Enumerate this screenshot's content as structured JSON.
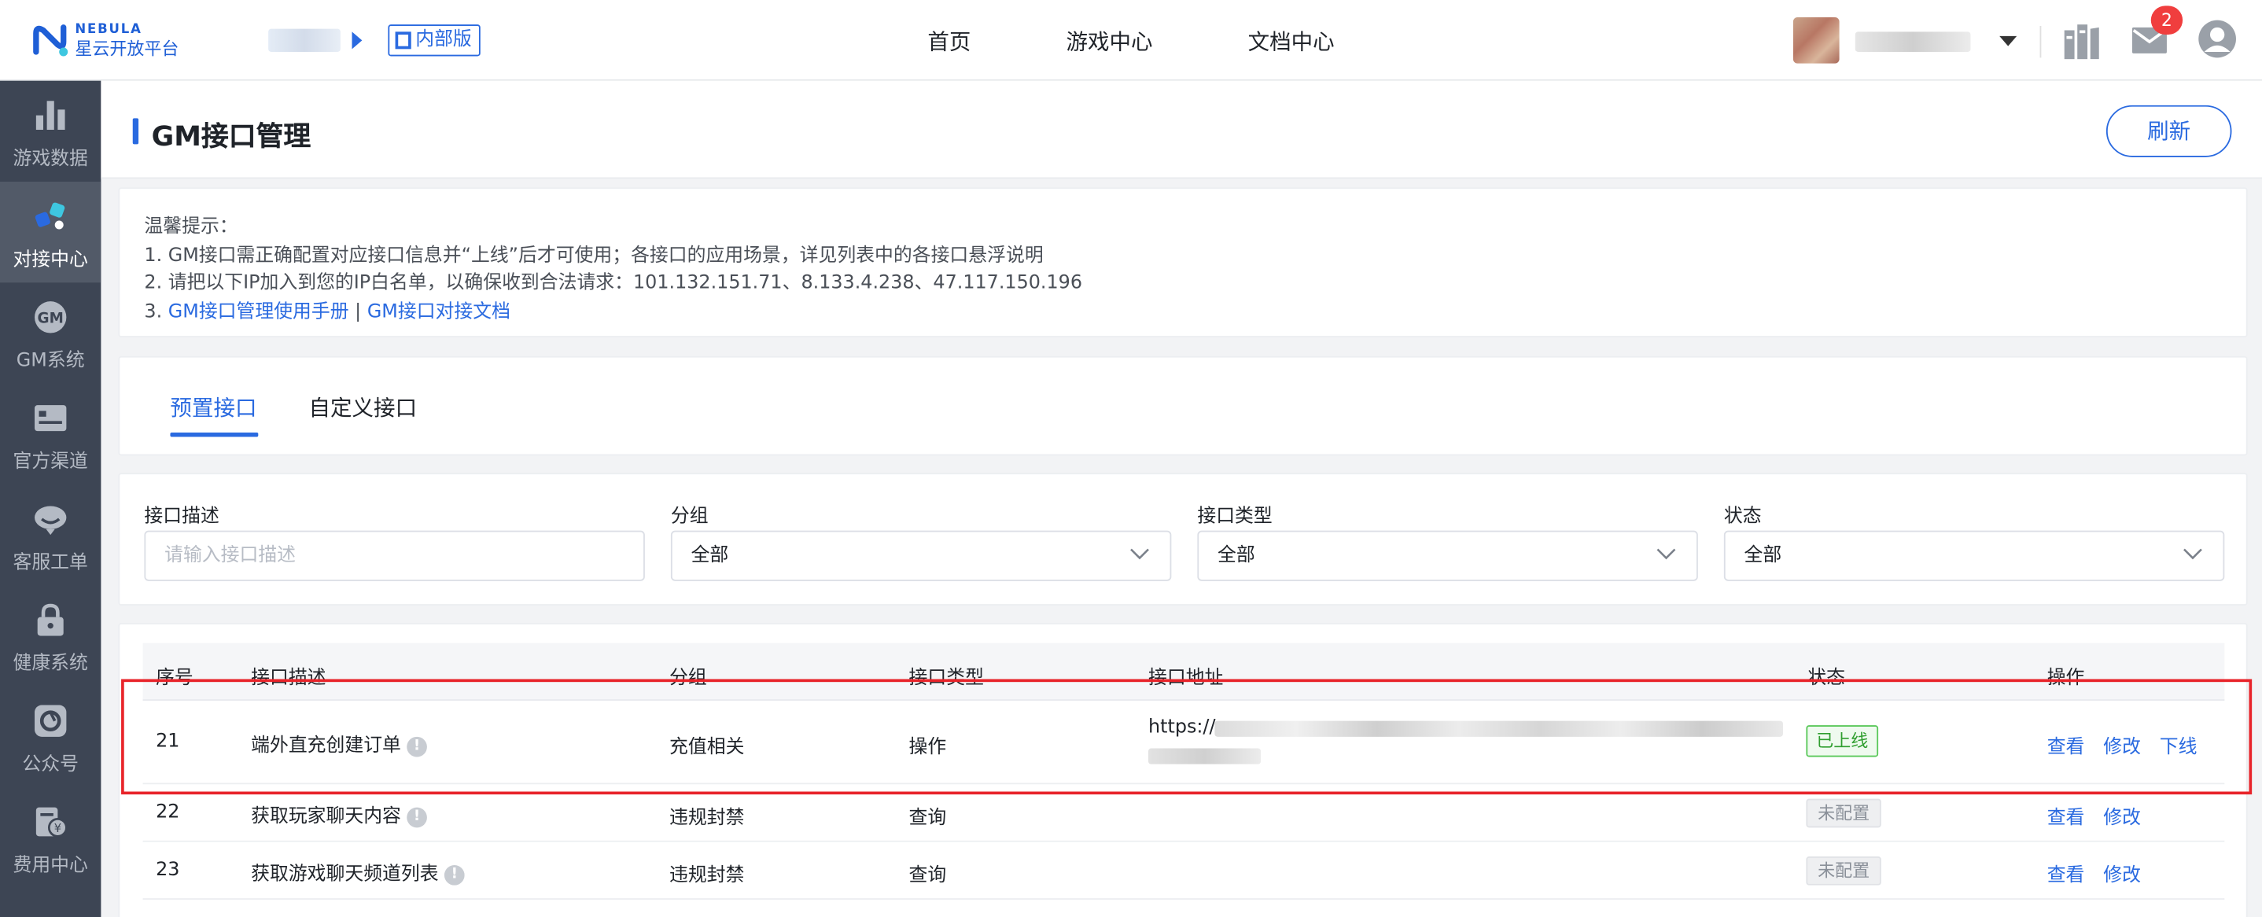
{
  "brand": {
    "logo_en": "NEBULA",
    "logo_cn": "星云开放平台",
    "primary_color": "#2a6ae0"
  },
  "header": {
    "badge_label": "内部版",
    "nav": [
      "首页",
      "游戏中心",
      "文档中心"
    ],
    "mail_count": "2"
  },
  "sidebar": {
    "items": [
      {
        "label": "游戏数据",
        "icon": "bar-chart-icon"
      },
      {
        "label": "对接中心",
        "icon": "link-icon",
        "active": true
      },
      {
        "label": "GM系统",
        "icon": "gm-icon"
      },
      {
        "label": "官方渠道",
        "icon": "card-icon"
      },
      {
        "label": "客服工单",
        "icon": "headset-icon"
      },
      {
        "label": "健康系统",
        "icon": "lock-icon"
      },
      {
        "label": "公众号",
        "icon": "shutter-icon"
      },
      {
        "label": "费用中心",
        "icon": "bill-icon"
      }
    ]
  },
  "page": {
    "title": "GM接口管理",
    "refresh_label": "刷新"
  },
  "tips": {
    "heading": "温馨提示：",
    "line1": "1. GM接口需正确配置对应接口信息并“上线”后才可使用；各接口的应用场景，详见列表中的各接口悬浮说明",
    "line2": "2. 请把以下IP加入到您的IP白名单，以确保收到合法请求：101.132.151.71、8.133.4.238、47.117.150.196",
    "line3_prefix": "3. ",
    "link_manual": "GM接口管理使用手册",
    "link_sep": "|",
    "link_doc": "GM接口对接文档"
  },
  "tabs": [
    "预置接口",
    "自定义接口"
  ],
  "filters": {
    "desc_label": "接口描述",
    "desc_placeholder": "请输入接口描述",
    "group_label": "分组",
    "group_value": "全部",
    "type_label": "接口类型",
    "type_value": "全部",
    "status_label": "状态",
    "status_value": "全部"
  },
  "table": {
    "columns": [
      "序号",
      "接口描述",
      "分组",
      "接口类型",
      "接口地址",
      "状态",
      "操作"
    ],
    "rows": [
      {
        "id": "21",
        "desc": "端外直充创建订单",
        "group": "充值相关",
        "type": "操作",
        "url_prefix": "https://s",
        "status": "已上线",
        "actions": [
          "查看",
          "修改",
          "下线"
        ]
      },
      {
        "id": "22",
        "desc": "获取玩家聊天内容",
        "group": "违规封禁",
        "type": "查询",
        "url_prefix": "",
        "status": "未配置",
        "actions": [
          "查看",
          "修改"
        ]
      },
      {
        "id": "23",
        "desc": "获取游戏聊天频道列表",
        "group": "违规封禁",
        "type": "查询",
        "url_prefix": "",
        "status": "未配置",
        "actions": [
          "查看",
          "修改"
        ]
      }
    ]
  }
}
